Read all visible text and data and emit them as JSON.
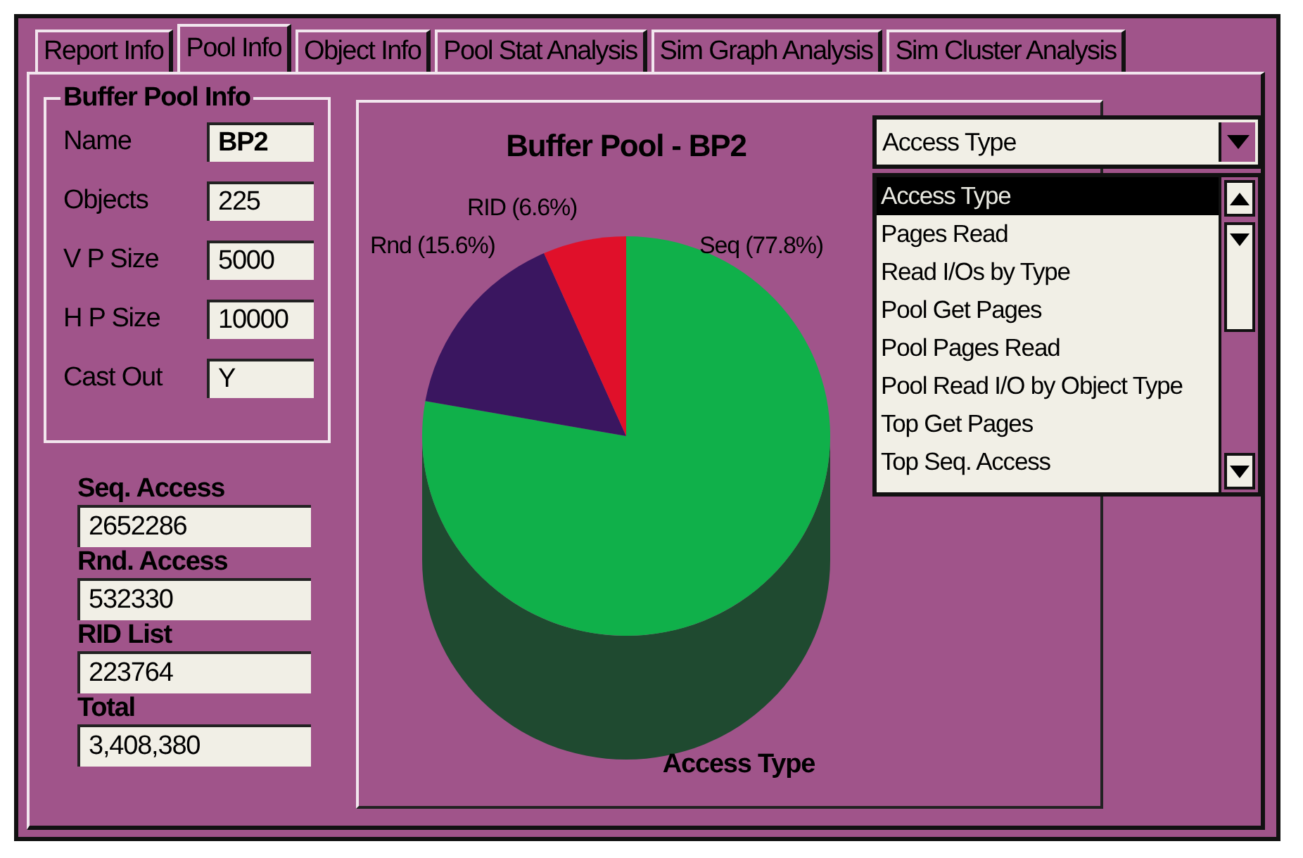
{
  "tabs": [
    {
      "label": "Report Info",
      "selected": false
    },
    {
      "label": "Pool Info",
      "selected": true
    },
    {
      "label": "Object Info",
      "selected": false
    },
    {
      "label": "Pool Stat Analysis",
      "selected": false
    },
    {
      "label": "Sim Graph Analysis",
      "selected": false
    },
    {
      "label": "Sim Cluster Analysis",
      "selected": false
    }
  ],
  "buffer_pool_info": {
    "title": "Buffer Pool Info",
    "fields": [
      {
        "label": "Name",
        "value": "BP2"
      },
      {
        "label": "Objects",
        "value": "225"
      },
      {
        "label": "V P Size",
        "value": "5000"
      },
      {
        "label": "H P Size",
        "value": "10000"
      },
      {
        "label": "Cast Out",
        "value": "Y"
      }
    ]
  },
  "access_totals": [
    {
      "label": "Seq. Access",
      "value": "2652286"
    },
    {
      "label": "Rnd. Access",
      "value": "532330"
    },
    {
      "label": "RID List",
      "value": "223764"
    },
    {
      "label": "Total",
      "value": "3,408,380"
    }
  ],
  "chart": {
    "chart_data": {
      "type": "pie",
      "title": "Buffer Pool - BP2",
      "xlabel": "Access Type",
      "categories": [
        "Seq (77.8%)",
        "Rnd (15.6%)",
        "RID (6.6%)"
      ],
      "values": [
        77.8,
        15.6,
        6.6
      ]
    }
  },
  "access_type_dropdown": {
    "value": "Access Type",
    "expanded": true,
    "options": [
      {
        "label": "Access Type",
        "selected": true
      },
      {
        "label": "Pages Read",
        "selected": false
      },
      {
        "label": "Read I/Os by Type",
        "selected": false
      },
      {
        "label": "Pool Get Pages",
        "selected": false
      },
      {
        "label": "Pool Pages Read",
        "selected": false
      },
      {
        "label": "Pool Read I/O by Object Type",
        "selected": false
      },
      {
        "label": "Top Get Pages",
        "selected": false
      },
      {
        "label": "Top Seq. Access",
        "selected": false
      }
    ]
  }
}
